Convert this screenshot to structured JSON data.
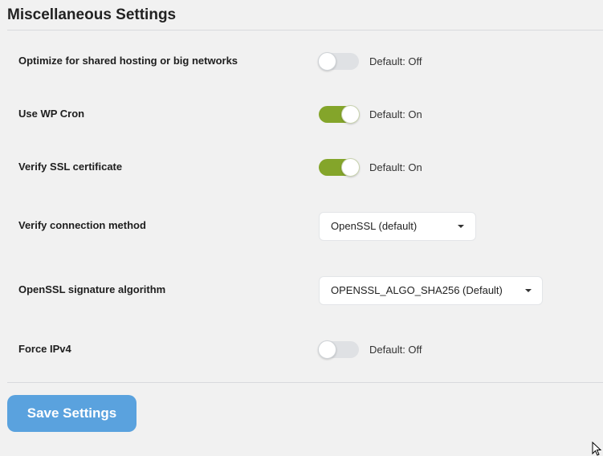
{
  "section": {
    "title": "Miscellaneous Settings"
  },
  "settings": [
    {
      "label": "Optimize for shared hosting or big networks",
      "control": "toggle",
      "enabled": false,
      "hint": "Default: Off"
    },
    {
      "label": "Use WP Cron",
      "control": "toggle",
      "enabled": true,
      "hint": "Default: On"
    },
    {
      "label": "Verify SSL certificate",
      "control": "toggle",
      "enabled": true,
      "hint": "Default: On"
    },
    {
      "label": "Verify connection method",
      "control": "select",
      "selected": "OpenSSL (default)"
    },
    {
      "label": "OpenSSL signature algorithm",
      "control": "select",
      "selected": "OPENSSL_ALGO_SHA256 (Default)"
    },
    {
      "label": "Force IPv4",
      "control": "toggle",
      "enabled": false,
      "hint": "Default: Off"
    }
  ],
  "actions": {
    "save_label": "Save Settings"
  },
  "colors": {
    "toggle_on": "#84a52a",
    "toggle_off": "#dfe1e4",
    "save_button": "#5aa2de",
    "background": "#f1f1f1"
  }
}
